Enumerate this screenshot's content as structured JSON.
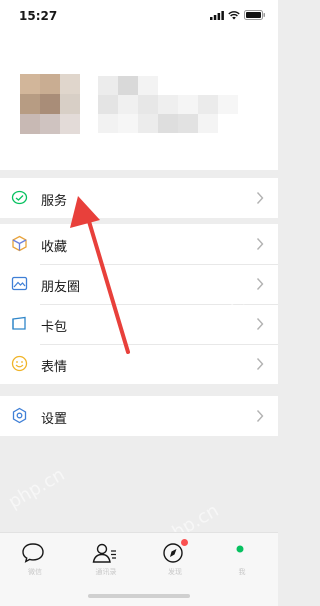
{
  "status_bar": {
    "time": "15:27"
  },
  "menu": {
    "services": {
      "label": "服务",
      "icon": "services-icon"
    },
    "main_items": [
      {
        "label": "收藏",
        "icon": "favorites-icon"
      },
      {
        "label": "朋友圈",
        "icon": "moments-icon"
      },
      {
        "label": "卡包",
        "icon": "card-wallet-icon"
      },
      {
        "label": "表情",
        "icon": "stickers-icon"
      }
    ],
    "settings": {
      "label": "设置",
      "icon": "settings-icon"
    }
  },
  "tab_bar": {
    "tabs": [
      {
        "label": "微信",
        "icon": "chat-bubble-icon"
      },
      {
        "label": "通讯录",
        "icon": "contacts-icon"
      },
      {
        "label": "发现",
        "icon": "discover-compass-icon"
      },
      {
        "label": "我",
        "icon": "me-icon"
      }
    ]
  },
  "watermark": {
    "text": "php.cn"
  },
  "colors": {
    "accent_green": "#07c160",
    "badge_red": "#fa5151",
    "annotation_arrow": "#e8403b"
  }
}
